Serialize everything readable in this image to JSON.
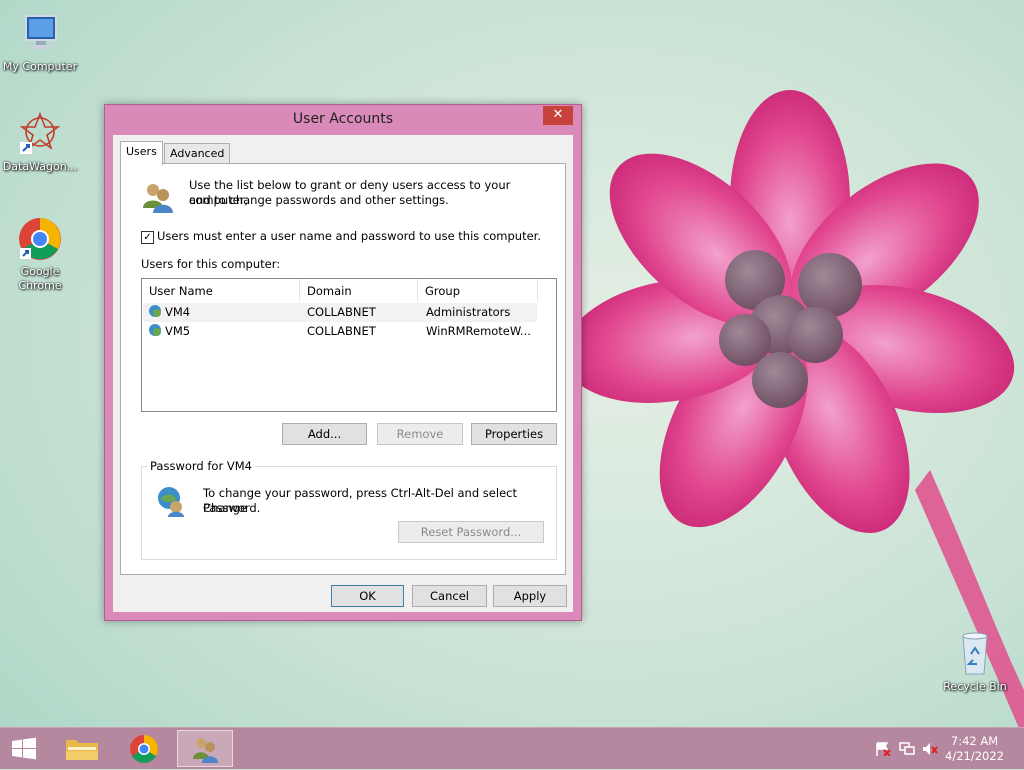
{
  "desktop": {
    "icons": [
      {
        "label": "My Computer"
      },
      {
        "label": "DataWagon..."
      },
      {
        "label": "Google Chrome"
      },
      {
        "label": "Recycle Bin"
      }
    ]
  },
  "window": {
    "title": "User Accounts",
    "close_glyph": "✕",
    "tabs": [
      {
        "label": "Users",
        "selected": true
      },
      {
        "label": "Advanced",
        "selected": false
      }
    ],
    "intro_text_line1": "Use the list below to grant or deny users access to your computer,",
    "intro_text_line2": "and to change passwords and other settings.",
    "require_login": {
      "label": "Users must enter a user name and password to use this computer.",
      "checked": true,
      "check_glyph": "✓"
    },
    "users_label": "Users for this computer:",
    "columns": [
      "User Name",
      "Domain",
      "Group"
    ],
    "rows": [
      {
        "name": "VM4",
        "domain": "COLLABNET",
        "group": "Administrators",
        "selected": true
      },
      {
        "name": "VM5",
        "domain": "COLLABNET",
        "group": "WinRMRemoteW...",
        "selected": false
      }
    ],
    "buttons": {
      "add": "Add...",
      "remove": "Remove",
      "properties": "Properties",
      "reset_password": "Reset Password...",
      "ok": "OK",
      "cancel": "Cancel",
      "apply": "Apply"
    },
    "password_group": {
      "title": "Password for VM4",
      "text_line1": "To change your password, press Ctrl-Alt-Del and select Change",
      "text_line2": "Password."
    }
  },
  "taskbar": {
    "time": "7:42 AM",
    "date": "4/21/2022"
  },
  "colors": {
    "accent": "#d98ab8",
    "taskbar": "#b5889f",
    "close": "#c7423a"
  }
}
